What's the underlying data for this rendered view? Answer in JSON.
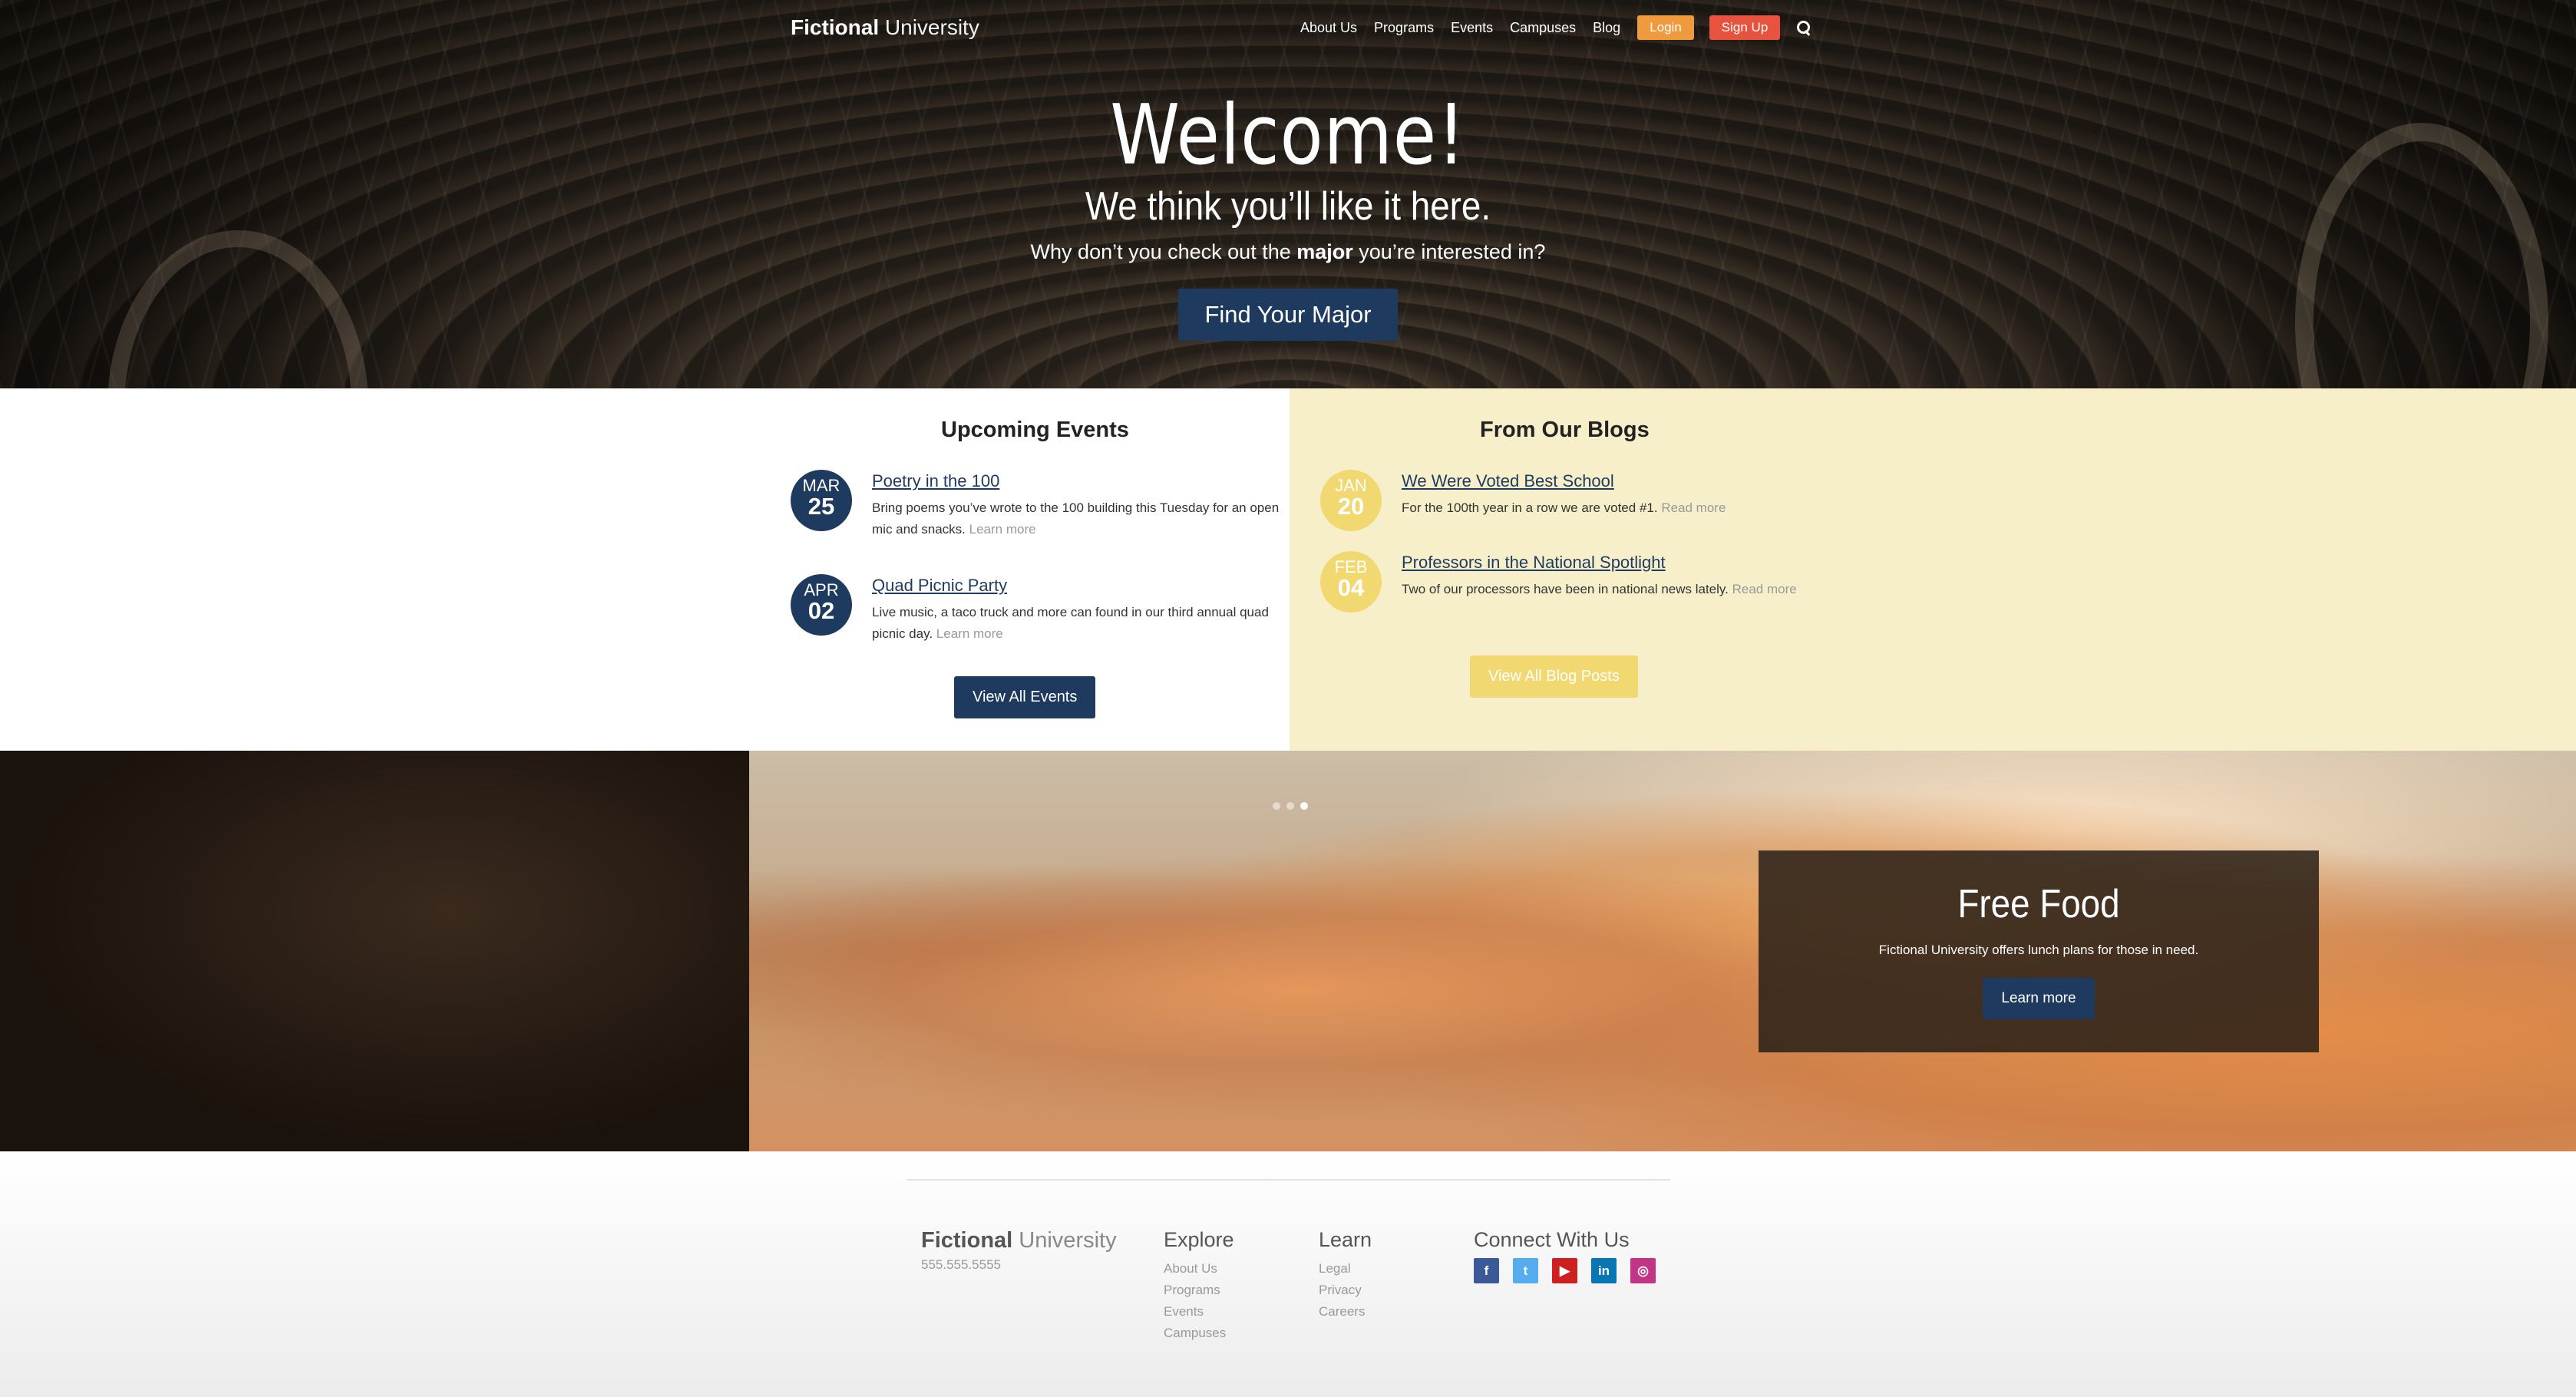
{
  "header": {
    "logo_bold": "Fictional",
    "logo_light": "University",
    "nav": [
      "About Us",
      "Programs",
      "Events",
      "Campuses",
      "Blog"
    ],
    "login_label": "Login",
    "signup_label": "Sign Up",
    "search_icon": "search-icon"
  },
  "hero": {
    "title": "Welcome!",
    "subtitle": "We think you’ll like it here.",
    "text_before": "Why don’t you check out the ",
    "text_bold": "major",
    "text_after": " you’re interested in?",
    "button_label": "Find Your Major"
  },
  "events": {
    "title": "Upcoming Events",
    "items": [
      {
        "month": "MAR",
        "day": "25",
        "title": "Poetry in the 100",
        "desc": "Bring poems you’ve wrote to the 100 building this Tuesday for an open mic and snacks.",
        "more": "Learn more"
      },
      {
        "month": "APR",
        "day": "02",
        "title": "Quad Picnic Party",
        "desc": "Live music, a taco truck and more can found in our third annual quad picnic day.",
        "more": "Learn more"
      }
    ],
    "button_label": "View All Events"
  },
  "blogs": {
    "title": "From Our Blogs",
    "items": [
      {
        "month": "JAN",
        "day": "20",
        "title": "We Were Voted Best School",
        "desc": "For the 100th year in a row we are voted #1.",
        "more": "Read more"
      },
      {
        "month": "FEB",
        "day": "04",
        "title": "Professors in the National Spotlight",
        "desc": "Two of our processors have been in national news lately.",
        "more": "Read more"
      }
    ],
    "button_label": "View All Blog Posts"
  },
  "slideshow": {
    "active_dot": 3,
    "dot_count": 3,
    "title": "Free Food",
    "text": "Fictional University offers lunch plans for those in need.",
    "button_label": "Learn more"
  },
  "footer": {
    "logo_bold": "Fictional",
    "logo_light": "University",
    "phone": "555.555.5555",
    "explore": {
      "title": "Explore",
      "links": [
        "About Us",
        "Programs",
        "Events",
        "Campuses"
      ]
    },
    "learn": {
      "title": "Learn",
      "links": [
        "Legal",
        "Privacy",
        "Careers"
      ]
    },
    "connect": {
      "title": "Connect With Us",
      "icons": [
        "facebook-icon",
        "twitter-icon",
        "youtube-icon",
        "linkedin-icon",
        "instagram-icon"
      ]
    }
  },
  "colors": {
    "brand_blue": "#1f3a5f",
    "login_orange": "#f09a3e",
    "signup_red": "#e8533f",
    "blog_yellow": "#f2d870",
    "blog_bg": "#f7efc9"
  }
}
